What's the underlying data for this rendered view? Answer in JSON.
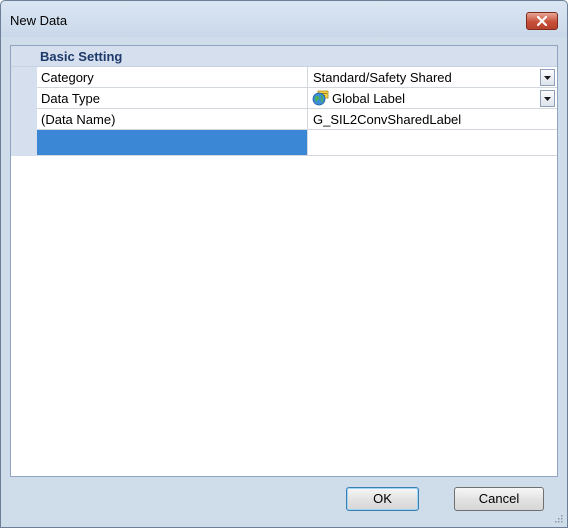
{
  "window": {
    "title": "New Data"
  },
  "grid": {
    "category_label": "Basic Setting",
    "rows": [
      {
        "name": "Category",
        "value": "Standard/Safety Shared",
        "has_dropdown": true,
        "icon": ""
      },
      {
        "name": "Data Type",
        "value": "Global Label",
        "has_dropdown": true,
        "icon": "globe-label-icon"
      },
      {
        "name": "(Data Name)",
        "value": "G_SIL2ConvSharedLabel",
        "has_dropdown": false,
        "icon": ""
      },
      {
        "name": "",
        "value": "",
        "has_dropdown": false,
        "icon": "",
        "selected": true
      }
    ]
  },
  "buttons": {
    "ok": "OK",
    "cancel": "Cancel"
  },
  "colors": {
    "selected_row": "#3c87d5",
    "category_text": "#1d3a6b",
    "window_frame": "#cfdcea",
    "close_button": "#c7503a"
  }
}
